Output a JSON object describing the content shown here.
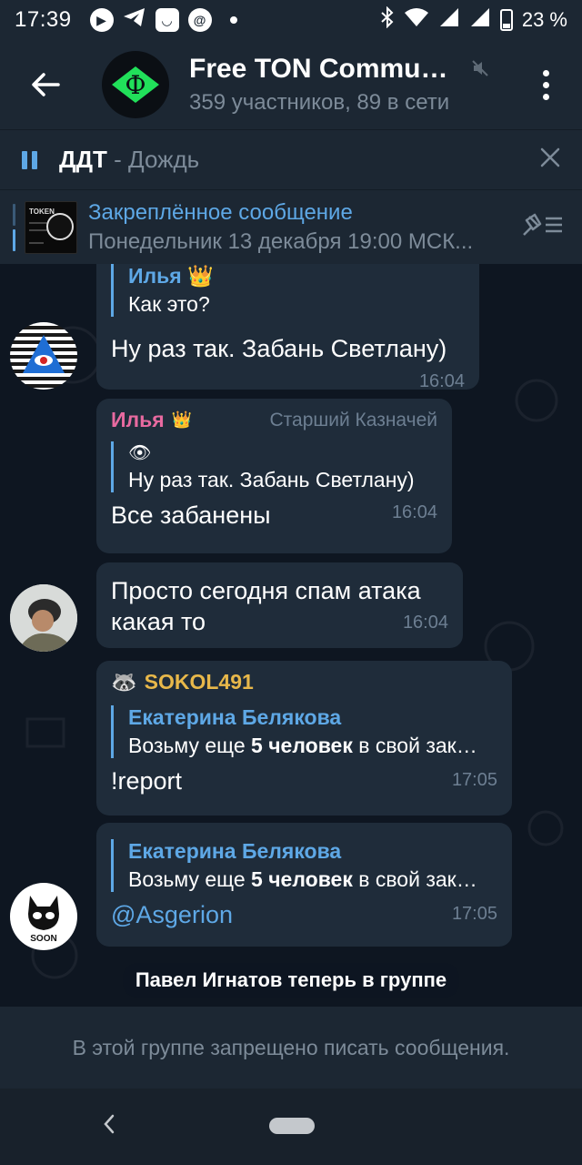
{
  "statusbar": {
    "time": "17:39",
    "battery": "23 %",
    "icons": [
      "play-icon",
      "telegram-icon",
      "inbox-icon",
      "at-icon",
      "dot-icon",
      "bluetooth-icon",
      "wifi-icon",
      "signal-icon",
      "battery-icon"
    ]
  },
  "header": {
    "title": "Free TON Communit…",
    "subtitle": "359 участников, 89 в сети",
    "avatar_glyph": "Ф",
    "accent": "#21e05a"
  },
  "player": {
    "artist": "ДДТ",
    "separator": " - ",
    "song": "Дождь"
  },
  "pinned": {
    "title": "Закреплённое сообщение",
    "body": "Понедельник 13 декабря 19:00 МСК...",
    "thumb_label": "TOKEN"
  },
  "messages": {
    "m1": {
      "reply_name": "Илья",
      "reply_text": "Как это?",
      "text": "Ну раз так. Забань Светлану)",
      "time": "16:04"
    },
    "m2": {
      "sender": "Илья",
      "role": "Старший Казначей",
      "reply_emoji": "👁",
      "reply_text": "Ну раз так. Забань Светлану)",
      "text": "Все забанены",
      "time": "16:04"
    },
    "m3": {
      "text_line1": "Просто сегодня спам атака",
      "text_line2": "какая то",
      "time": "16:04"
    },
    "m4": {
      "sender": "SOKOL491",
      "reply_name": "Екатерина Белякова",
      "reply_pre": "Возьму еще ",
      "reply_bold": "5 человек",
      "reply_post": " в свой зак…",
      "text": "!report",
      "time": "17:05"
    },
    "m5": {
      "reply_name": "Екатерина Белякова",
      "reply_pre": "Возьму еще ",
      "reply_bold": "5 человек",
      "reply_post": " в свой зак…",
      "text": "@Asgerion",
      "time": "17:05"
    }
  },
  "service_message": "Павел Игнатов теперь в группе",
  "soon_label": "SOON",
  "bottom_notice": "В этой группе запрещено писать сообщения.",
  "colors": {
    "ilya_name": "#e86aa0",
    "sokol_name": "#e8b84a",
    "link": "#5ea8e6"
  }
}
